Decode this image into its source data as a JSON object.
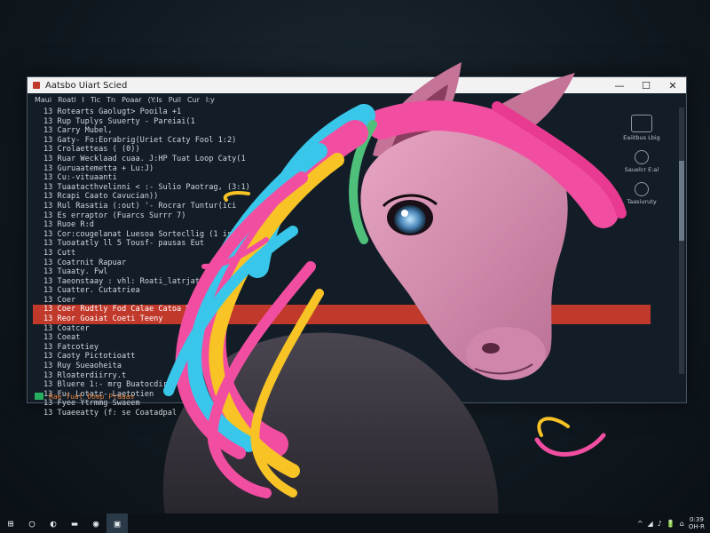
{
  "window": {
    "title": "Aatsbo Uiart Scied",
    "controls": {
      "minimize": "—",
      "maximize": "☐",
      "close": "✕"
    }
  },
  "menu": [
    "Maui",
    "Roatl",
    "I",
    "Tic",
    "Tn",
    "Poaar",
    "(Y:Is",
    "Puil",
    "Cur",
    "I:y"
  ],
  "code_lines": [
    {
      "text": "13  Rotearts Gaolugt> Pooila +1",
      "hl": false
    },
    {
      "text": "13  Rup Tuplys Suuerty - Pareiai(1",
      "hl": false
    },
    {
      "text": "13  Carry Mubel,",
      "hl": false
    },
    {
      "text": "13  Gaty- Fo:Eorabrig(Uriet Ccaty Fool 1:2)",
      "hl": false
    },
    {
      "text": "13  Crolaetteas ( (0))",
      "hl": false
    },
    {
      "text": "13  Ruar Wecklaad cuaa. J:HP Tuat Loop Caty(1",
      "hl": false
    },
    {
      "text": "13  Guruaatemetta + Lu:J)",
      "hl": false
    },
    {
      "text": "13  Cu:-vituaanti",
      "hl": false
    },
    {
      "text": "13  Tuaatacthvelinni < :- Sulio Paotrag, (3:1)",
      "hl": false
    },
    {
      "text": "13  Rcapi Caato Cavucian))",
      "hl": false
    },
    {
      "text": "13  Rul Rasatia (:out) '- Rocrar Tuntur(ici",
      "hl": false
    },
    {
      "text": "13  Es erraptor (Fuarcs Surrr 7)",
      "hl": false
    },
    {
      "text": "13  Ruoe R:d",
      "hl": false
    },
    {
      "text": "13  Cor:cougelanat Luesoa Sortecllig (1 is",
      "hl": false
    },
    {
      "text": "13  Tuoatatly ll 5 Tousf- pausas Eut",
      "hl": false
    },
    {
      "text": "13  Cutt",
      "hl": false
    },
    {
      "text": "13  Coatrnit Rapuar",
      "hl": false
    },
    {
      "text": "13  Tuaaty. Fwl",
      "hl": false
    },
    {
      "text": "13  Taeonstaay : vhl: Roati_latrjatt",
      "hl": false
    },
    {
      "text": "13  Cuatter. Cutatriea",
      "hl": false
    },
    {
      "text": "13  Coer",
      "hl": false
    },
    {
      "text": "13  Coer Rudtly Fod Calae Catoa Rtaem",
      "hl": true
    },
    {
      "text": "13  Reor Goaiat Coeti Teeny",
      "hl": true
    },
    {
      "text": "13  Coatcer",
      "hl": false
    },
    {
      "text": "13  Coeat",
      "hl": false
    },
    {
      "text": "13  Fatcotiey",
      "hl": false
    },
    {
      "text": "13  Caoty Pictotioatt",
      "hl": false
    },
    {
      "text": "13  Ruy Sueaoheita",
      "hl": false
    },
    {
      "text": "13  Rloaterdiirry.t",
      "hl": false
    },
    {
      "text": "13  Bluere 1:- mrg Buatocdir",
      "hl": false
    },
    {
      "text": "13  Fu: Lotatr- Laetotien",
      "hl": false
    },
    {
      "text": "13  Fyee Ytrmmg Swaeem",
      "hl": false
    },
    {
      "text": "13  Tuaeeatty (f: se Coatadpal",
      "hl": false
    }
  ],
  "status": "Rae Tual Doep Praaas",
  "right_panel": [
    "Eaiitbus Lbig",
    "Sauelcr E:al",
    "Taasiuruty"
  ],
  "taskbar": {
    "start": "⊞",
    "apps": [
      "○",
      "◐",
      "▬",
      "◉",
      "▣"
    ],
    "tray": [
      "^",
      "◢",
      "♪",
      "🔋",
      "⌂"
    ],
    "clock_time": "0:39",
    "clock_date": "OH-R"
  },
  "colors": {
    "background": "#111a21",
    "editor_bg": "#131d27",
    "highlight": "#c0392b",
    "mane_pink": "#f24ea1",
    "mane_cyan": "#38c6ea",
    "mane_yellow": "#f7c325",
    "mane_green": "#4fc07a",
    "horse_pink": "#d98fb1"
  },
  "scene": {
    "subject": "pink-horse-icon",
    "eye": "eye-icon"
  }
}
